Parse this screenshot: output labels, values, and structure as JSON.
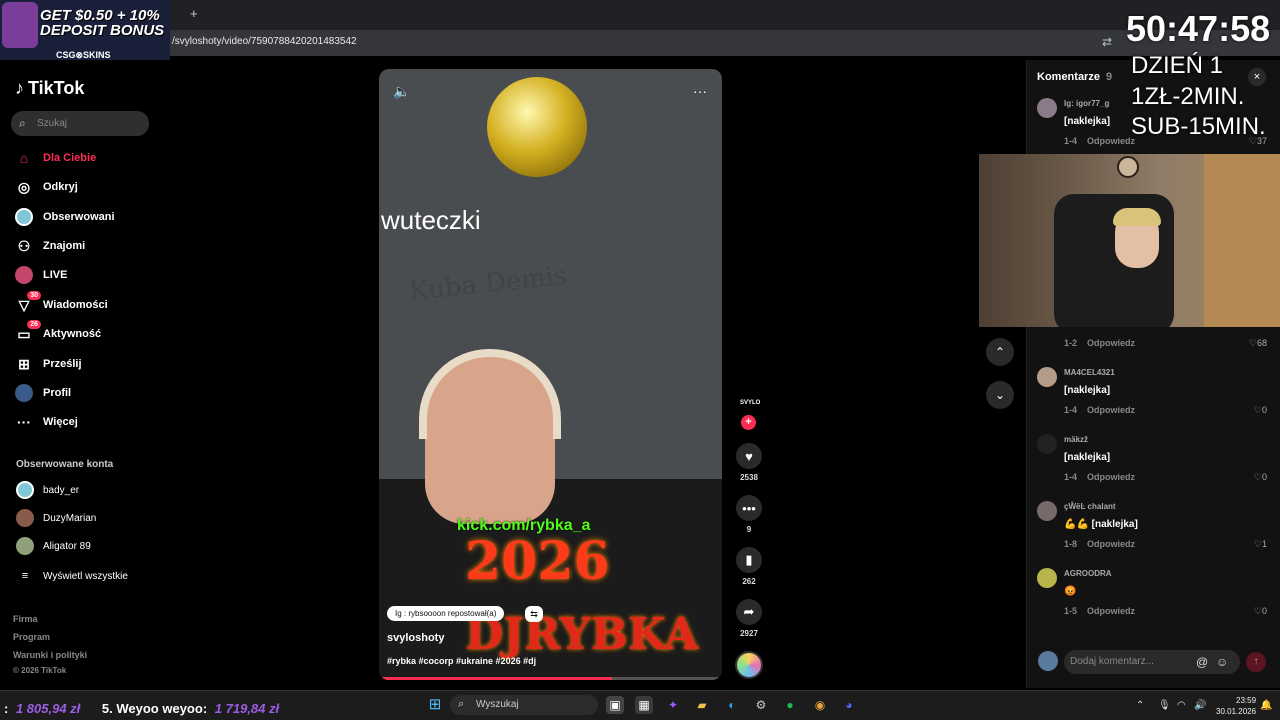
{
  "browser": {
    "url": "/svyloshoty/video/7590788420201483542",
    "new_tab": "+"
  },
  "ad": {
    "line1": "GET $0.50 + 10%",
    "line2": "DEPOSIT BONUS",
    "brand": "CSG⊗SKINS"
  },
  "sidebar": {
    "logo": "TikTok",
    "search_placeholder": "Szukaj",
    "items": [
      {
        "label": "Dla Ciebie",
        "icon": "home-icon",
        "active": true
      },
      {
        "label": "Odkryj",
        "icon": "compass-icon"
      },
      {
        "label": "Obserwowani",
        "icon": "following-icon"
      },
      {
        "label": "Znajomi",
        "icon": "friends-icon"
      },
      {
        "label": "LIVE",
        "icon": "live-icon"
      },
      {
        "label": "Wiadomości",
        "icon": "messages-icon",
        "badge": "30"
      },
      {
        "label": "Aktywność",
        "icon": "activity-icon",
        "badge": "26"
      },
      {
        "label": "Prześlij",
        "icon": "upload-icon"
      },
      {
        "label": "Profil",
        "icon": "profile-icon"
      },
      {
        "label": "Więcej",
        "icon": "more-icon"
      }
    ],
    "following_label": "Obserwowane konta",
    "following": [
      {
        "name": "bady_er",
        "color": "#7fc6d6"
      },
      {
        "name": "DuzyMarian",
        "color": "#8a5a4a"
      },
      {
        "name": "Aligator 89",
        "color": "#8fa07a"
      }
    ],
    "show_all": "Wyświetl wszystkie",
    "footer": [
      "Firma",
      "Program",
      "Warunki i polityki",
      "© 2026 TikTok"
    ]
  },
  "video": {
    "overlay_word": "wuteczki",
    "wall_text": "Kuba Demis",
    "kick_text": "kick.com/rybka_a",
    "big_year": "2026",
    "big_name": "DJRYBKA",
    "repost_text": "Ig : rybsoooon repostował(a)",
    "author": "svyloshoty",
    "hashtags": "#rybka #cocorp #ukraine #2026 #dj",
    "progress_fraction": 0.68
  },
  "actions": {
    "creator_label": "SVYLO",
    "likes": "2538",
    "comments": "9",
    "saves": "262",
    "shares": "2927"
  },
  "comments": {
    "title": "Komentarze",
    "count": "9",
    "input_placeholder": "Dodaj komentarz...",
    "items": [
      {
        "user": "Ig: igor77_g",
        "text": "[naklejka]",
        "meta": "1-4",
        "reply": "Odpowiedz",
        "likes": "37",
        "color": "#8a7a8a"
      },
      {
        "user": "",
        "text": "",
        "meta": "1-2",
        "reply": "Odpowiedz",
        "likes": "68",
        "color": "#555"
      },
      {
        "user": "MA4CEL4321",
        "text": "[naklejka]",
        "meta": "1-4",
        "reply": "Odpowiedz",
        "likes": "0",
        "color": "#b59c88"
      },
      {
        "user": "mäkzž",
        "text": "[naklejka]",
        "meta": "1-4",
        "reply": "Odpowiedz",
        "likes": "0",
        "color": "#222"
      },
      {
        "user": "çŴëĿ chalant",
        "text": "💪💪 [naklejka]",
        "meta": "1-8",
        "reply": "Odpowiedz",
        "likes": "1",
        "color": "#776a6a"
      },
      {
        "user": "AGROODRA",
        "text": "😡",
        "meta": "1-5",
        "reply": "Odpowiedz",
        "likes": "0",
        "color": "#b8b64a"
      }
    ]
  },
  "stream": {
    "timer": "50:47:58",
    "day": "DZIEŃ 1",
    "rate": "1ZŁ-2MIN.",
    "sub": "SUB-15MIN."
  },
  "taskbar": {
    "ticker_prefix": ":",
    "ticker_amount1": "1 805,94 zł",
    "ticker_rank": "5. Weyoo weyoo:",
    "ticker_amount2": "1 719,84 zł",
    "search_placeholder": "Wyszukaj",
    "time": "23:59",
    "date": "30.01.2026"
  }
}
